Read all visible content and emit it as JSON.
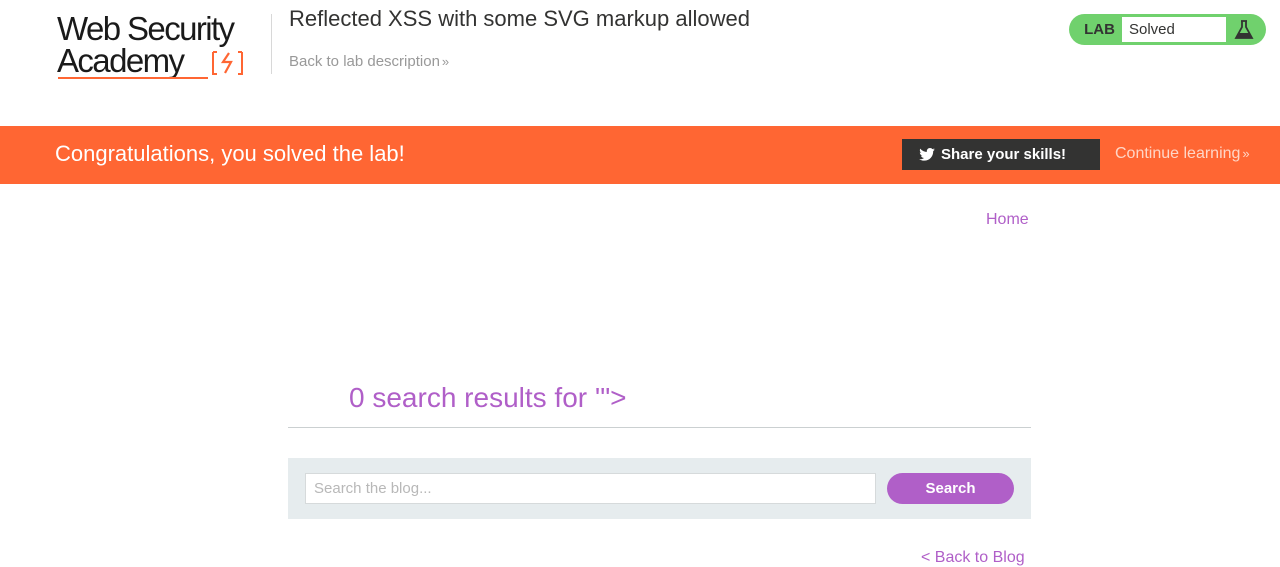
{
  "header": {
    "logo_line1": "Web Security",
    "logo_line2": "Academy",
    "lab_title": "Reflected XSS with some SVG markup allowed",
    "back_to_lab_label": "Back to lab description",
    "lab_status": {
      "tag": "LAB",
      "status": "Solved",
      "icon": "flask-icon",
      "color": "#70d16d"
    }
  },
  "banner": {
    "message": "Congratulations, you solved the lab!",
    "share_label": "Share your skills!",
    "share_icon": "twitter-icon",
    "continue_label": "Continue learning",
    "color": "#ff6633"
  },
  "nav": {
    "home_label": "Home"
  },
  "main": {
    "results_heading": "0 search results for '\">",
    "search": {
      "placeholder": "Search the blog...",
      "value": "",
      "button_label": "Search"
    },
    "back_to_blog_label": "< Back to Blog"
  },
  "colors": {
    "accent": "#b05fc8",
    "brand_orange": "#ff6633",
    "dark": "#333332"
  }
}
